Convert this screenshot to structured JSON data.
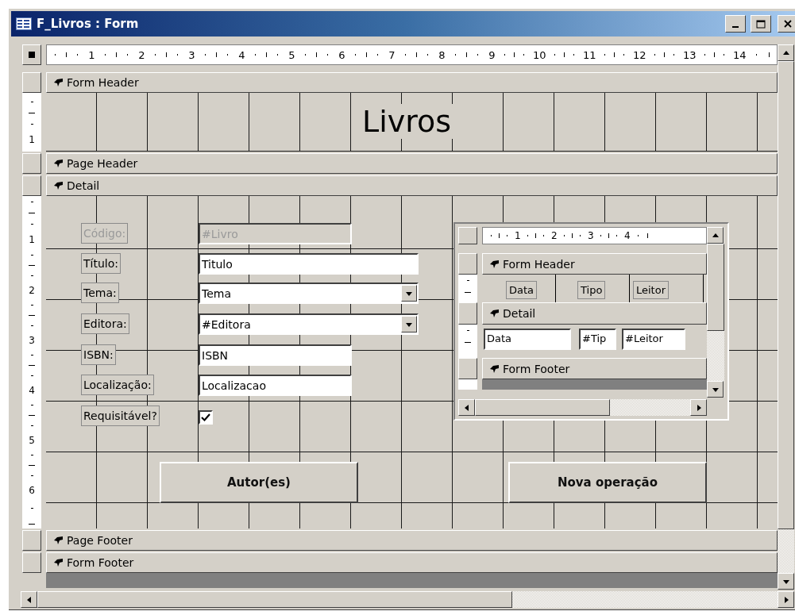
{
  "window": {
    "title": "F_Livros : Form"
  },
  "ruler": [
    "1",
    "2",
    "3",
    "4",
    "5",
    "6",
    "7",
    "8",
    "9",
    "10",
    "11",
    "12",
    "13",
    "14"
  ],
  "sections": [
    {
      "kind": "title",
      "label": "Form Header",
      "ruler": [
        "1"
      ],
      "title": "Livros"
    },
    {
      "kind": "empty",
      "label": "Page Header"
    },
    {
      "kind": "controls",
      "label": "Detail",
      "ruler": [
        "1",
        "2",
        "3",
        "4",
        "5",
        "6"
      ]
    },
    {
      "kind": "empty",
      "label": "Page Footer"
    },
    {
      "kind": "empty",
      "label": "Form Footer"
    }
  ],
  "detail": {
    "fields": [
      {
        "kind": "text",
        "label": "Código:",
        "value": "#Livro",
        "disabled": true
      },
      {
        "kind": "text",
        "label": "Título:",
        "value": "Titulo",
        "disabled": false
      },
      {
        "kind": "combo",
        "label": "Tema:",
        "value": "Tema",
        "disabled": false
      },
      {
        "kind": "combo",
        "label": "Editora:",
        "value": "#Editora",
        "disabled": false
      },
      {
        "kind": "text",
        "label": "ISBN:",
        "value": "ISBN",
        "disabled": false
      },
      {
        "kind": "text",
        "label": "Localização:",
        "value": "Localizacao",
        "disabled": false
      },
      {
        "kind": "checkbox",
        "label": "Requisitável?",
        "checked": true,
        "disabled": false
      }
    ],
    "buttons": [
      "Autor(es)",
      "Nova operação"
    ],
    "subform": {
      "ruler": [
        "1",
        "2",
        "3",
        "4"
      ],
      "sections": [
        {
          "label": "Form Header"
        },
        {
          "label": "Detail"
        },
        {
          "label": "Form Footer"
        }
      ],
      "header_labels": [
        "Data",
        "Tipo",
        "Leitor"
      ],
      "fields": [
        "Data",
        "#Tip",
        "#Leitor"
      ]
    }
  }
}
